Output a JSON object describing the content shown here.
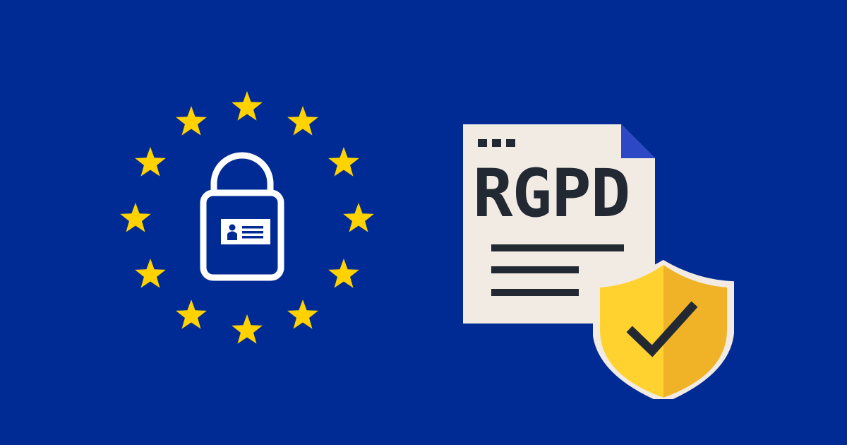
{
  "document": {
    "title": "RGPD"
  },
  "colors": {
    "background": "#012b94",
    "star": "#ffd200",
    "lock_outline": "#ffffff",
    "document_paper": "#f1ebe3",
    "document_fold": "#2c48c4",
    "document_text": "#222933",
    "shield_light": "#ffd22f",
    "shield_dark": "#f0b327",
    "checkmark": "#222933"
  },
  "icons": {
    "stars": "eu-star-icon",
    "lock": "padlock-id-card-icon",
    "document": "document-icon",
    "shield": "shield-check-icon"
  },
  "star_count": 12
}
